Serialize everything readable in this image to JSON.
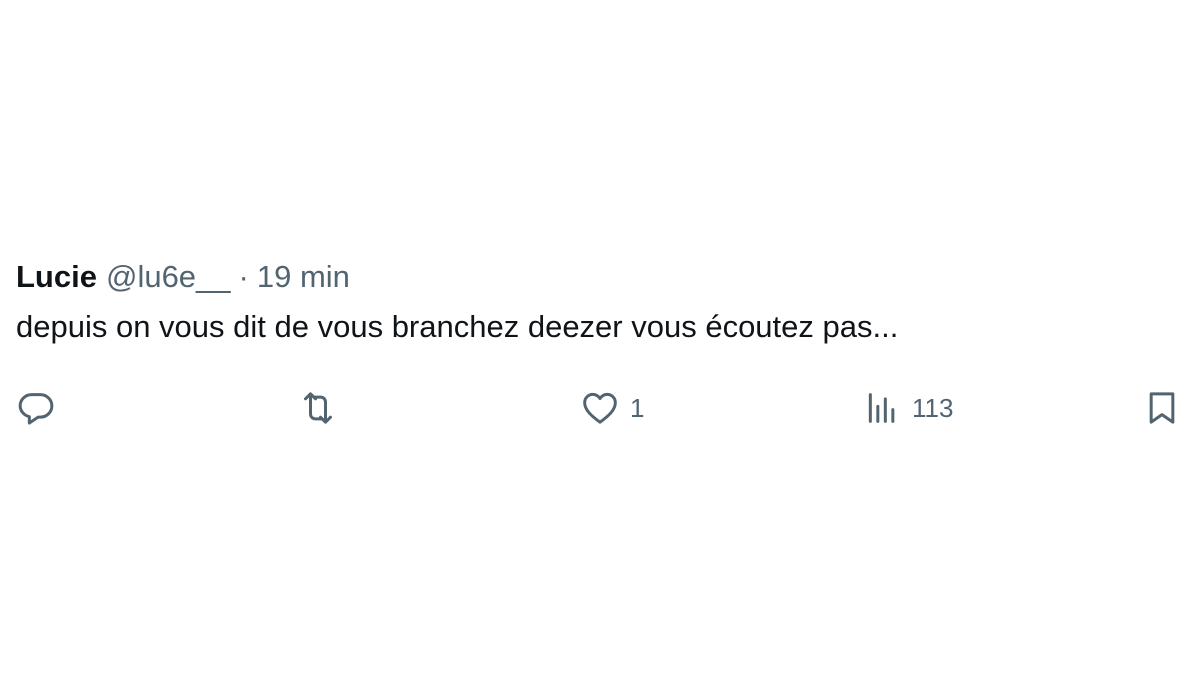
{
  "tweet": {
    "display_name": "Lucie",
    "handle": "@lu6e__",
    "separator": "·",
    "timestamp": "19 min",
    "text": "depuis on vous dit de vous branchez deezer vous écoutez pas..."
  },
  "actions": {
    "reply": {
      "icon": "reply-icon"
    },
    "retweet": {
      "icon": "retweet-icon"
    },
    "like": {
      "icon": "heart-icon",
      "count": "1"
    },
    "views": {
      "icon": "views-bar-chart-icon",
      "count": "113"
    },
    "bookmark": {
      "icon": "bookmark-icon"
    }
  },
  "colors": {
    "text_primary": "#0f1419",
    "text_secondary": "#536471",
    "background": "#ffffff"
  }
}
